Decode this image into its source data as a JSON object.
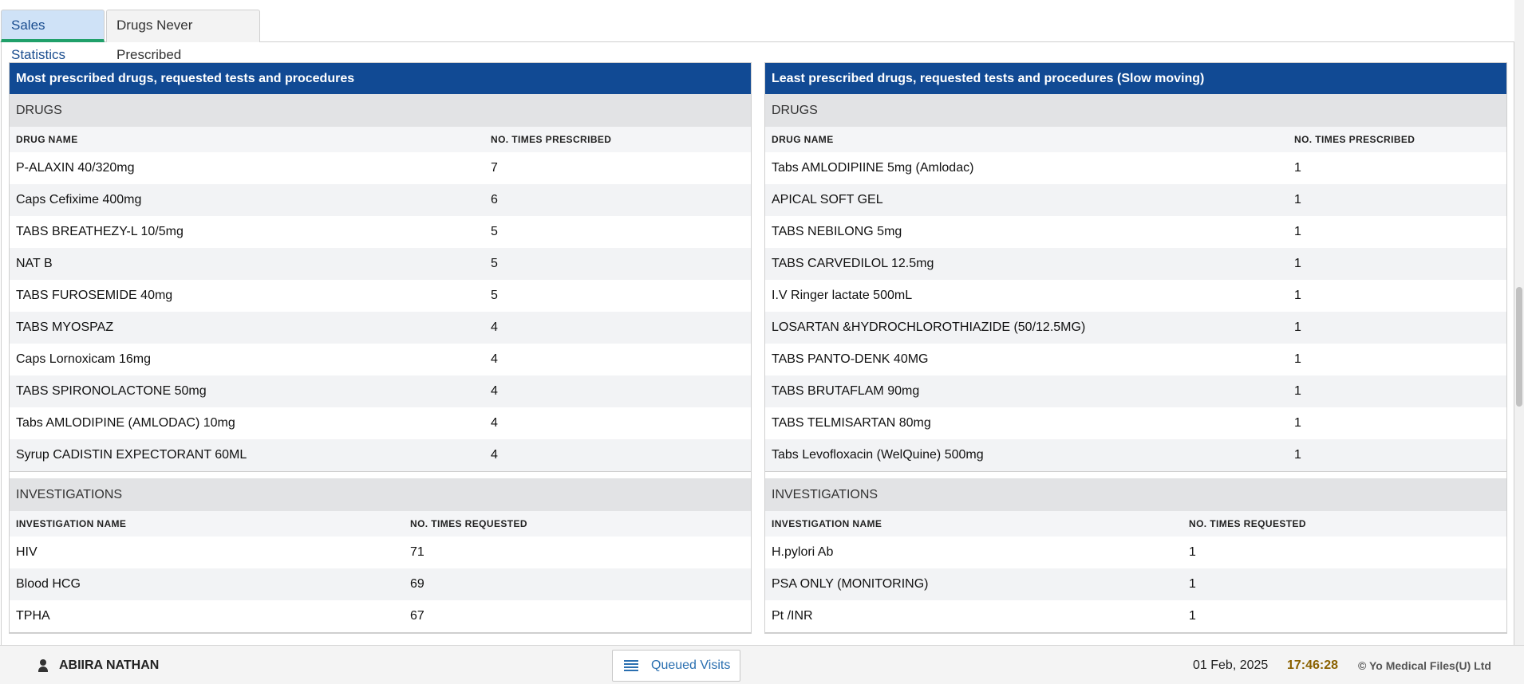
{
  "tabs": [
    {
      "label": "Sales Statistics"
    },
    {
      "label": "Drugs Never Prescribed"
    }
  ],
  "left_panel": {
    "title": "Most prescribed drugs, requested tests and procedures",
    "drugs": {
      "section_title": "DRUGS",
      "col_name": "DRUG NAME",
      "col_count": "NO. TIMES PRESCRIBED",
      "rows": [
        {
          "name": "P-ALAXIN 40/320mg",
          "count": "7"
        },
        {
          "name": "Caps Cefixime 400mg",
          "count": "6"
        },
        {
          "name": "TABS BREATHEZY-L 10/5mg",
          "count": "5"
        },
        {
          "name": "NAT B",
          "count": "5"
        },
        {
          "name": "TABS FUROSEMIDE 40mg",
          "count": "5"
        },
        {
          "name": "TABS MYOSPAZ",
          "count": "4"
        },
        {
          "name": "Caps Lornoxicam 16mg",
          "count": "4"
        },
        {
          "name": "TABS SPIRONOLACTONE 50mg",
          "count": "4"
        },
        {
          "name": "Tabs AMLODIPINE (AMLODAC) 10mg",
          "count": "4"
        },
        {
          "name": "Syrup CADISTIN EXPECTORANT 60ML",
          "count": "4"
        }
      ]
    },
    "investigations": {
      "section_title": "INVESTIGATIONS",
      "col_name": "INVESTIGATION NAME",
      "col_count": "NO. TIMES REQUESTED",
      "rows": [
        {
          "name": "HIV",
          "count": "71"
        },
        {
          "name": "Blood HCG",
          "count": "69"
        },
        {
          "name": "TPHA",
          "count": "67"
        }
      ]
    }
  },
  "right_panel": {
    "title": "Least prescribed drugs, requested tests and procedures (Slow moving)",
    "drugs": {
      "section_title": "DRUGS",
      "col_name": "DRUG NAME",
      "col_count": "NO. TIMES PRESCRIBED",
      "rows": [
        {
          "name": "Tabs AMLODIPIINE 5mg (Amlodac)",
          "count": "1"
        },
        {
          "name": "APICAL SOFT GEL",
          "count": "1"
        },
        {
          "name": "TABS NEBILONG 5mg",
          "count": "1"
        },
        {
          "name": "TABS CARVEDILOL 12.5mg",
          "count": "1"
        },
        {
          "name": "I.V Ringer lactate 500mL",
          "count": "1"
        },
        {
          "name": "LOSARTAN &HYDROCHLOROTHIAZIDE (50/12.5MG)",
          "count": "1"
        },
        {
          "name": "TABS PANTO-DENK 40MG",
          "count": "1"
        },
        {
          "name": "TABS BRUTAFLAM 90mg",
          "count": "1"
        },
        {
          "name": "TABS TELMISARTAN 80mg",
          "count": "1"
        },
        {
          "name": "Tabs Levofloxacin (WelQuine) 500mg",
          "count": "1"
        }
      ]
    },
    "investigations": {
      "section_title": "INVESTIGATIONS",
      "col_name": "INVESTIGATION NAME",
      "col_count": "NO. TIMES REQUESTED",
      "rows": [
        {
          "name": "H.pylori Ab",
          "count": "1"
        },
        {
          "name": "PSA ONLY (MONITORING)",
          "count": "1"
        },
        {
          "name": "Pt /INR",
          "count": "1"
        }
      ]
    }
  },
  "footer": {
    "user_name": "ABIIRA NATHAN",
    "queue_label": "Queued Visits",
    "date": "01 Feb, 2025",
    "time": "17:46:28",
    "copyright": "© Yo Medical Files(U) Ltd"
  },
  "colors": {
    "panel_header": "#114a94",
    "active_tab": "#cfe2f7",
    "tab_underline": "#20a06a",
    "time": "#8a6100"
  }
}
